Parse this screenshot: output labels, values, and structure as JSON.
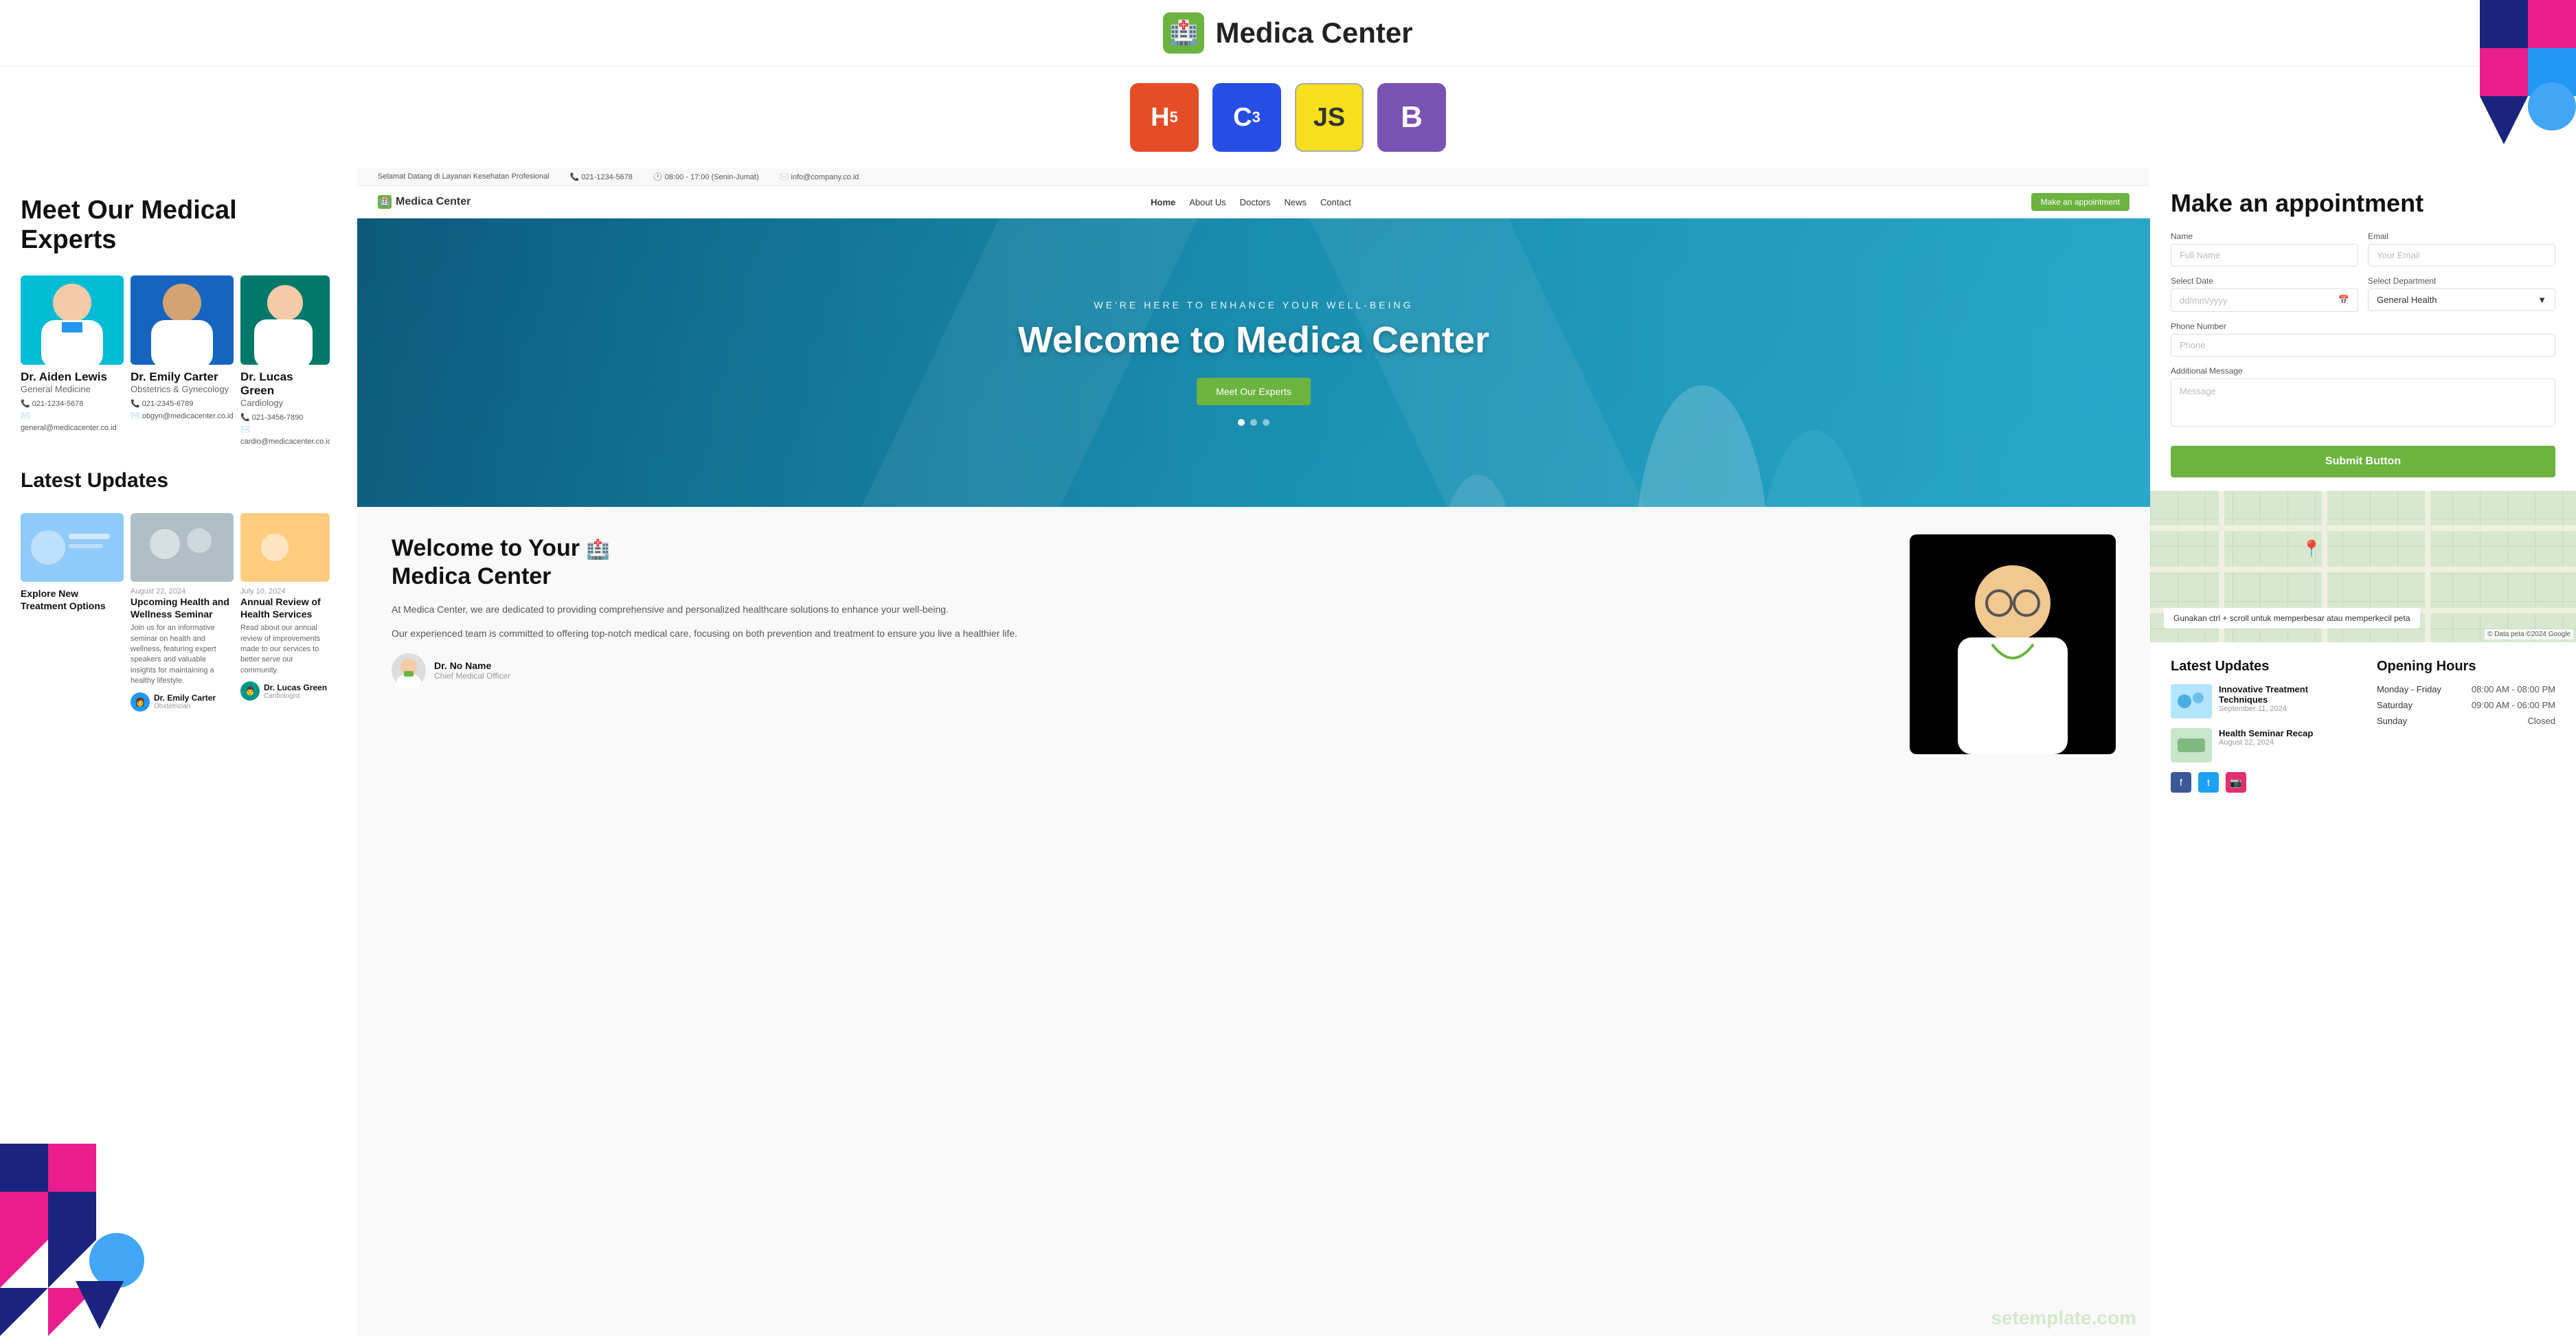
{
  "site": {
    "name": "Medica Center",
    "logo_icon": "🏥",
    "tagline": "Selamat Datang di Layanan Kesehatan Profesional"
  },
  "top_bar": {
    "phone": "021-1234-5678",
    "hours": "08:00 - 17:00 (Senin-Jumat)",
    "email": "info@company.co.id"
  },
  "nav": {
    "links": [
      "Home",
      "About Us",
      "Doctors",
      "News",
      "Contact"
    ],
    "cta": "Make an appointment"
  },
  "hero": {
    "subtitle": "WE'RE HERE TO ENHANCE YOUR WELL-BEING",
    "title": "Welcome to Medica Center",
    "cta": "Meet Our Experts"
  },
  "welcome": {
    "title": "Welcome to Your Medica Center",
    "desc1": "At Medica Center, we are dedicated to providing comprehensive and personalized healthcare solutions to enhance your well-being.",
    "desc2": "Our experienced team is committed to offering top-notch medical care, focusing on both prevention and treatment to ensure you live a healthier life.",
    "cmo_name": "Dr. No Name",
    "cmo_role": "Chief Medical Officer"
  },
  "doctors": {
    "section_title": "Meet Our Medical Experts",
    "list": [
      {
        "name": "Dr. Aiden Lewis",
        "specialty": "General Medicine",
        "phone": "021-1234-5678",
        "email": "general@medicacenter.co.id"
      },
      {
        "name": "Dr. Emily Carter",
        "specialty": "Obstetrics & Gynecology",
        "phone": "021-2345-6789",
        "email": "obgyn@medicacenter.co.id"
      },
      {
        "name": "Dr. Lucas Green",
        "specialty": "Cardiology",
        "phone": "021-3456-7890",
        "email": "cardio@medicacenter.co.id"
      }
    ]
  },
  "latest_updates": {
    "section_title": "Latest Updates",
    "items": [
      {
        "date": "",
        "title": "Explore New Treatment Options",
        "desc": "",
        "author": "",
        "role": ""
      },
      {
        "date": "August 22, 2024",
        "title": "Upcoming Health and Wellness Seminar",
        "desc": "Join us for an informative seminar on health and wellness, featuring expert speakers and valuable insights for maintaining a healthy lifestyle.",
        "author": "Dr. Emily Carter",
        "role": "Obstetrician"
      },
      {
        "date": "July 10, 2024",
        "title": "Annual Review of Health Services",
        "desc": "Read about our annual review of improvements made to our services to better serve our community.",
        "author": "Dr. Lucas Green",
        "role": "Cardiologist"
      }
    ]
  },
  "appointment": {
    "title": "Make an appointment",
    "fields": {
      "name_label": "Name",
      "name_placeholder": "Full Name",
      "email_label": "Email",
      "email_placeholder": "Your Email",
      "date_label": "Select Date",
      "date_placeholder": "dd/mm/yyyy",
      "dept_label": "Select Department",
      "dept_value": "General Health",
      "phone_label": "Phone Number",
      "phone_placeholder": "Phone",
      "message_label": "Additional Message",
      "message_placeholder": "Message"
    },
    "submit": "Submit Button"
  },
  "map": {
    "overlay_text": "Gunakan ctrl + scroll untuk memperbesar atau memperkecil peta"
  },
  "footer_updates": {
    "title": "Latest Updates",
    "items": [
      {
        "title": "Innovative Treatment Techniques",
        "date": "September 11, 2024"
      },
      {
        "title": "Health Seminar Recap",
        "date": "August 22, 2024"
      }
    ]
  },
  "opening_hours": {
    "title": "Opening Hours",
    "rows": [
      {
        "day": "Monday - Friday",
        "hours": "08:00 AM - 08:00 PM"
      },
      {
        "day": "Saturday",
        "hours": "09:00 AM - 06:00 PM"
      },
      {
        "day": "Sunday",
        "hours": "Closed"
      }
    ]
  },
  "tech_badges": [
    {
      "label": "5",
      "type": "html"
    },
    {
      "label": "3",
      "type": "css"
    },
    {
      "label": "JS",
      "type": "js"
    },
    {
      "label": "B",
      "type": "bs"
    }
  ],
  "colors": {
    "green": "#6cb33f",
    "blue": "#2196f3",
    "dark": "#1a237e",
    "pink": "#e91e8c"
  }
}
